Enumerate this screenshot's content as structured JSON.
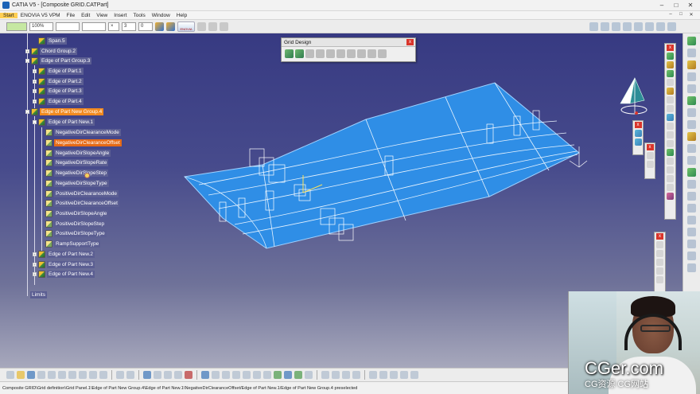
{
  "window": {
    "title": "CATIA V5 - [Composite GRID.CATPart]",
    "controls": [
      "–",
      "□",
      "✕"
    ],
    "doc_controls": [
      "–",
      "□",
      "✕"
    ]
  },
  "menu": [
    "Start",
    "ENOVIA V5 VPM",
    "File",
    "Edit",
    "View",
    "Insert",
    "Tools",
    "Window",
    "Help"
  ],
  "toolbar": {
    "zoom_value": "100%",
    "num_value_a": "3",
    "num_value_b": "0",
    "enovia_label": "ENOVIA"
  },
  "tree": {
    "nodes": [
      {
        "label": "Span.5",
        "icon": "surface-icon"
      },
      {
        "label": "Chord Group.2",
        "icon": "surface-icon"
      },
      {
        "label": "Edge of Part Group.3",
        "icon": "surface-icon"
      },
      {
        "label": "Edge of Part.1",
        "icon": "surface-icon"
      },
      {
        "label": "Edge of Part.2",
        "icon": "surface-icon"
      },
      {
        "label": "Edge of Part.3",
        "icon": "surface-icon"
      },
      {
        "label": "Edge of Part.4",
        "icon": "surface-icon"
      },
      {
        "label": "Edge of Part New Group.4",
        "icon": "surface-icon",
        "state": "selected"
      },
      {
        "label": "Edge of Part New.1",
        "icon": "surface-icon"
      },
      {
        "label": "NegativeDirClearanceMode",
        "icon": "parameter-icon"
      },
      {
        "label": "NegativeDirClearanceOffset",
        "icon": "parameter-icon",
        "state": "highlight"
      },
      {
        "label": "NegativeDirSlopeAngle",
        "icon": "parameter-icon"
      },
      {
        "label": "NegativeDirSlopeRate",
        "icon": "parameter-icon"
      },
      {
        "label": "NegativeDirSlopeStep",
        "icon": "parameter-icon"
      },
      {
        "label": "NegativeDirSlopeType",
        "icon": "parameter-icon"
      },
      {
        "label": "PositiveDirClearanceMode",
        "icon": "parameter-icon"
      },
      {
        "label": "PositiveDirClearanceOffset",
        "icon": "parameter-icon"
      },
      {
        "label": "PositiveDirSlopeAngle",
        "icon": "parameter-icon"
      },
      {
        "label": "PositiveDirSlopeStep",
        "icon": "parameter-icon"
      },
      {
        "label": "PositiveDirSlopeType",
        "icon": "parameter-icon"
      },
      {
        "label": "RampSupportType",
        "icon": "parameter-icon"
      },
      {
        "label": "Edge of Part New.2",
        "icon": "surface-icon"
      },
      {
        "label": "Edge of Part New.3",
        "icon": "surface-icon"
      },
      {
        "label": "Edge of Part New.4",
        "icon": "surface-icon"
      }
    ],
    "limits": "Limits"
  },
  "grid_design": {
    "title": "Grid Design",
    "close": "x"
  },
  "status": {
    "text": "Composite GRID\\Grid definition\\Grid Panel.1\\Edge of Part New Group.4\\Edge of Part New.1\\NegativeDirClearanceOffset/Edge of Part New.1/Edge of Part New Group.4 preselected"
  },
  "watermark": {
    "main": "CGer.com",
    "sub": "CG资源 CG网站"
  },
  "colors": {
    "surface": "#2f8ee6",
    "selection": "#f28a1f",
    "background_top": "#373a82"
  }
}
